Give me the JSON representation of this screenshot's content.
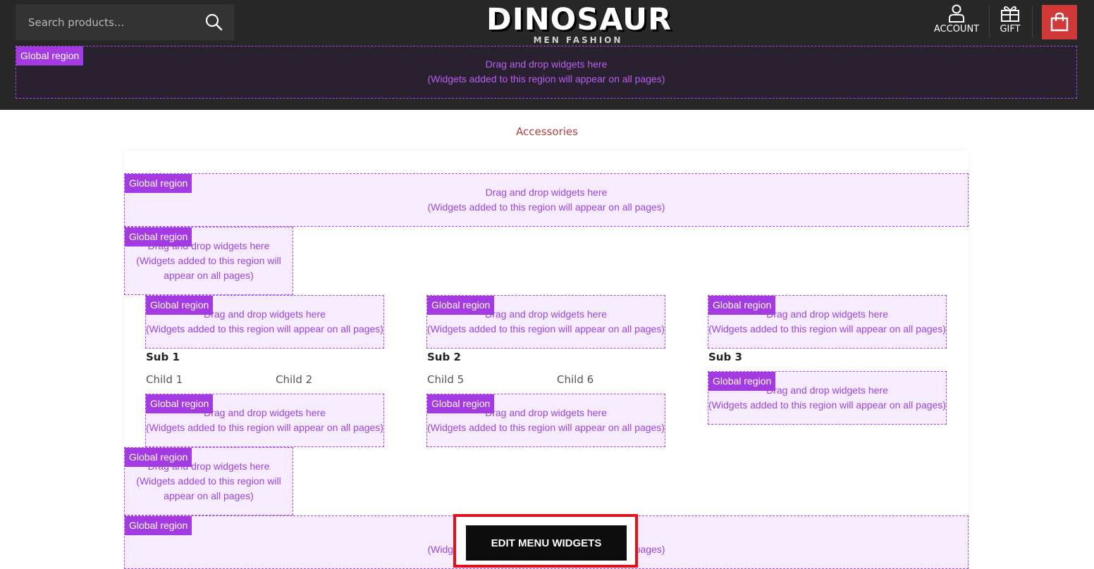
{
  "header": {
    "search": {
      "placeholder": "Search products..."
    },
    "logo": {
      "title": "DINOSAUR",
      "subtitle": "MEN FASHION"
    },
    "account_label": "ACCOUNT",
    "gift_label": "GIFT"
  },
  "region": {
    "tag": "Global region",
    "line1": "Drag and drop widgets here",
    "line2": "(Widgets added to this region will appear on all pages)",
    "narrow1": "Drag and drop widgets here",
    "narrow2": "(Widgets added to this region will",
    "narrow3": "appear on all pages)"
  },
  "menu": {
    "category": "Accessories",
    "subs": [
      {
        "label": "Sub 1",
        "children": [
          "Child 1",
          "Child 2"
        ]
      },
      {
        "label": "Sub 2",
        "children": [
          "Child 5",
          "Child 6"
        ]
      },
      {
        "label": "Sub 3",
        "children": []
      }
    ]
  },
  "edit_button": "EDIT MENU WIDGETS",
  "colors": {
    "header_bg": "#272727",
    "cart_accent": "#d03737",
    "region_tag": "#a43ae1",
    "edit_highlight": "#e6101a"
  },
  "icons": {
    "search": "search-icon",
    "account": "user-icon",
    "gift": "gift-icon",
    "cart": "shopping-bag-icon"
  }
}
